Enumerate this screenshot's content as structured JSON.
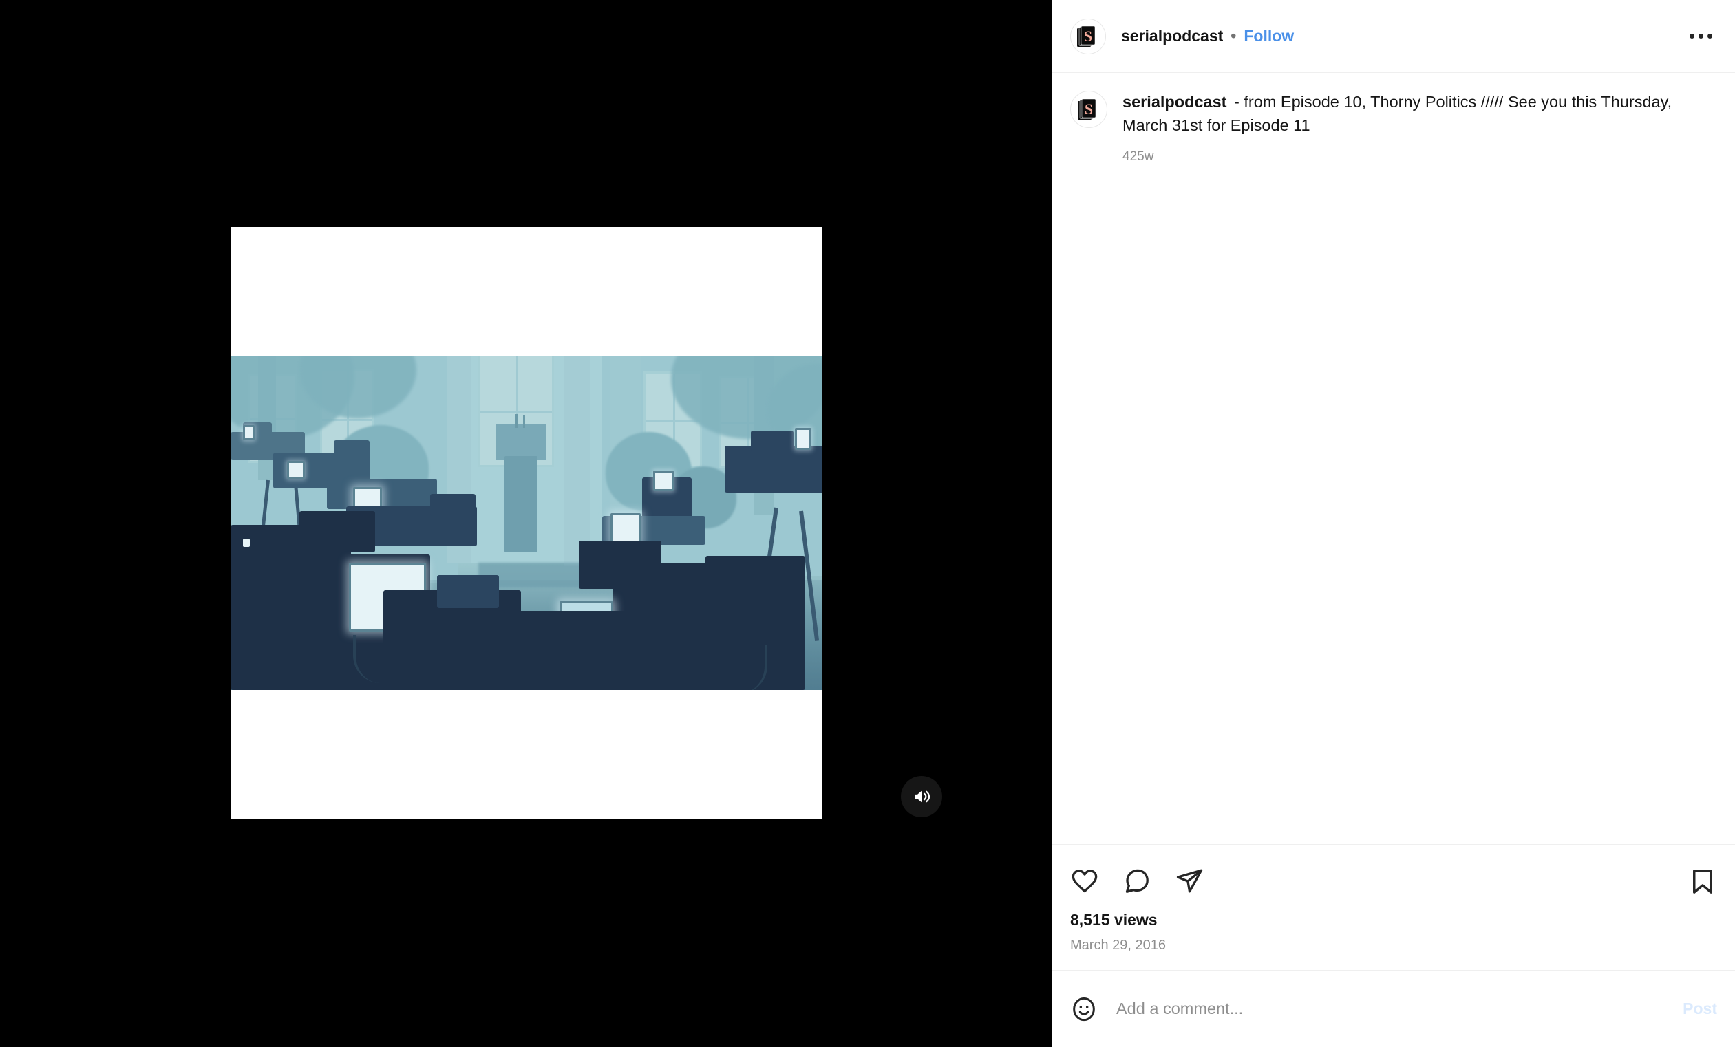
{
  "header": {
    "username": "serialpodcast",
    "separator": "•",
    "follow_label": "Follow",
    "more_label": "More options",
    "avatar_alt": "serialpodcast profile picture"
  },
  "caption": {
    "username": "serialpodcast",
    "text": "- from Episode 10, Thorny Politics ///// See you this Thursday, March 31st for Episode 11",
    "timestamp": "425w"
  },
  "actions": {
    "like_label": "Like",
    "comment_label": "Comment",
    "share_label": "Share",
    "save_label": "Save",
    "views": "8,515 views",
    "date": "March 29, 2016"
  },
  "comment_box": {
    "placeholder": "Add a comment...",
    "value": "",
    "post_label": "Post",
    "emoji_label": "Emoji"
  },
  "media": {
    "type": "video",
    "audio_state": "unmuted",
    "audio_label": "Toggle audio",
    "alt": "Illustration of a press corps of television cameras and glowing monitors facing an empty podium outside a building in teal and navy tones"
  },
  "colors": {
    "link_blue": "#4a90e8",
    "post_disabled_blue": "#dbeafd",
    "text_primary": "#161616",
    "text_secondary": "#8e8e8e",
    "divider": "#efefef",
    "page_background": "#000000",
    "panel_background": "#ffffff",
    "art_teal": "#8fc0c9",
    "art_navy": "#1e3047"
  }
}
